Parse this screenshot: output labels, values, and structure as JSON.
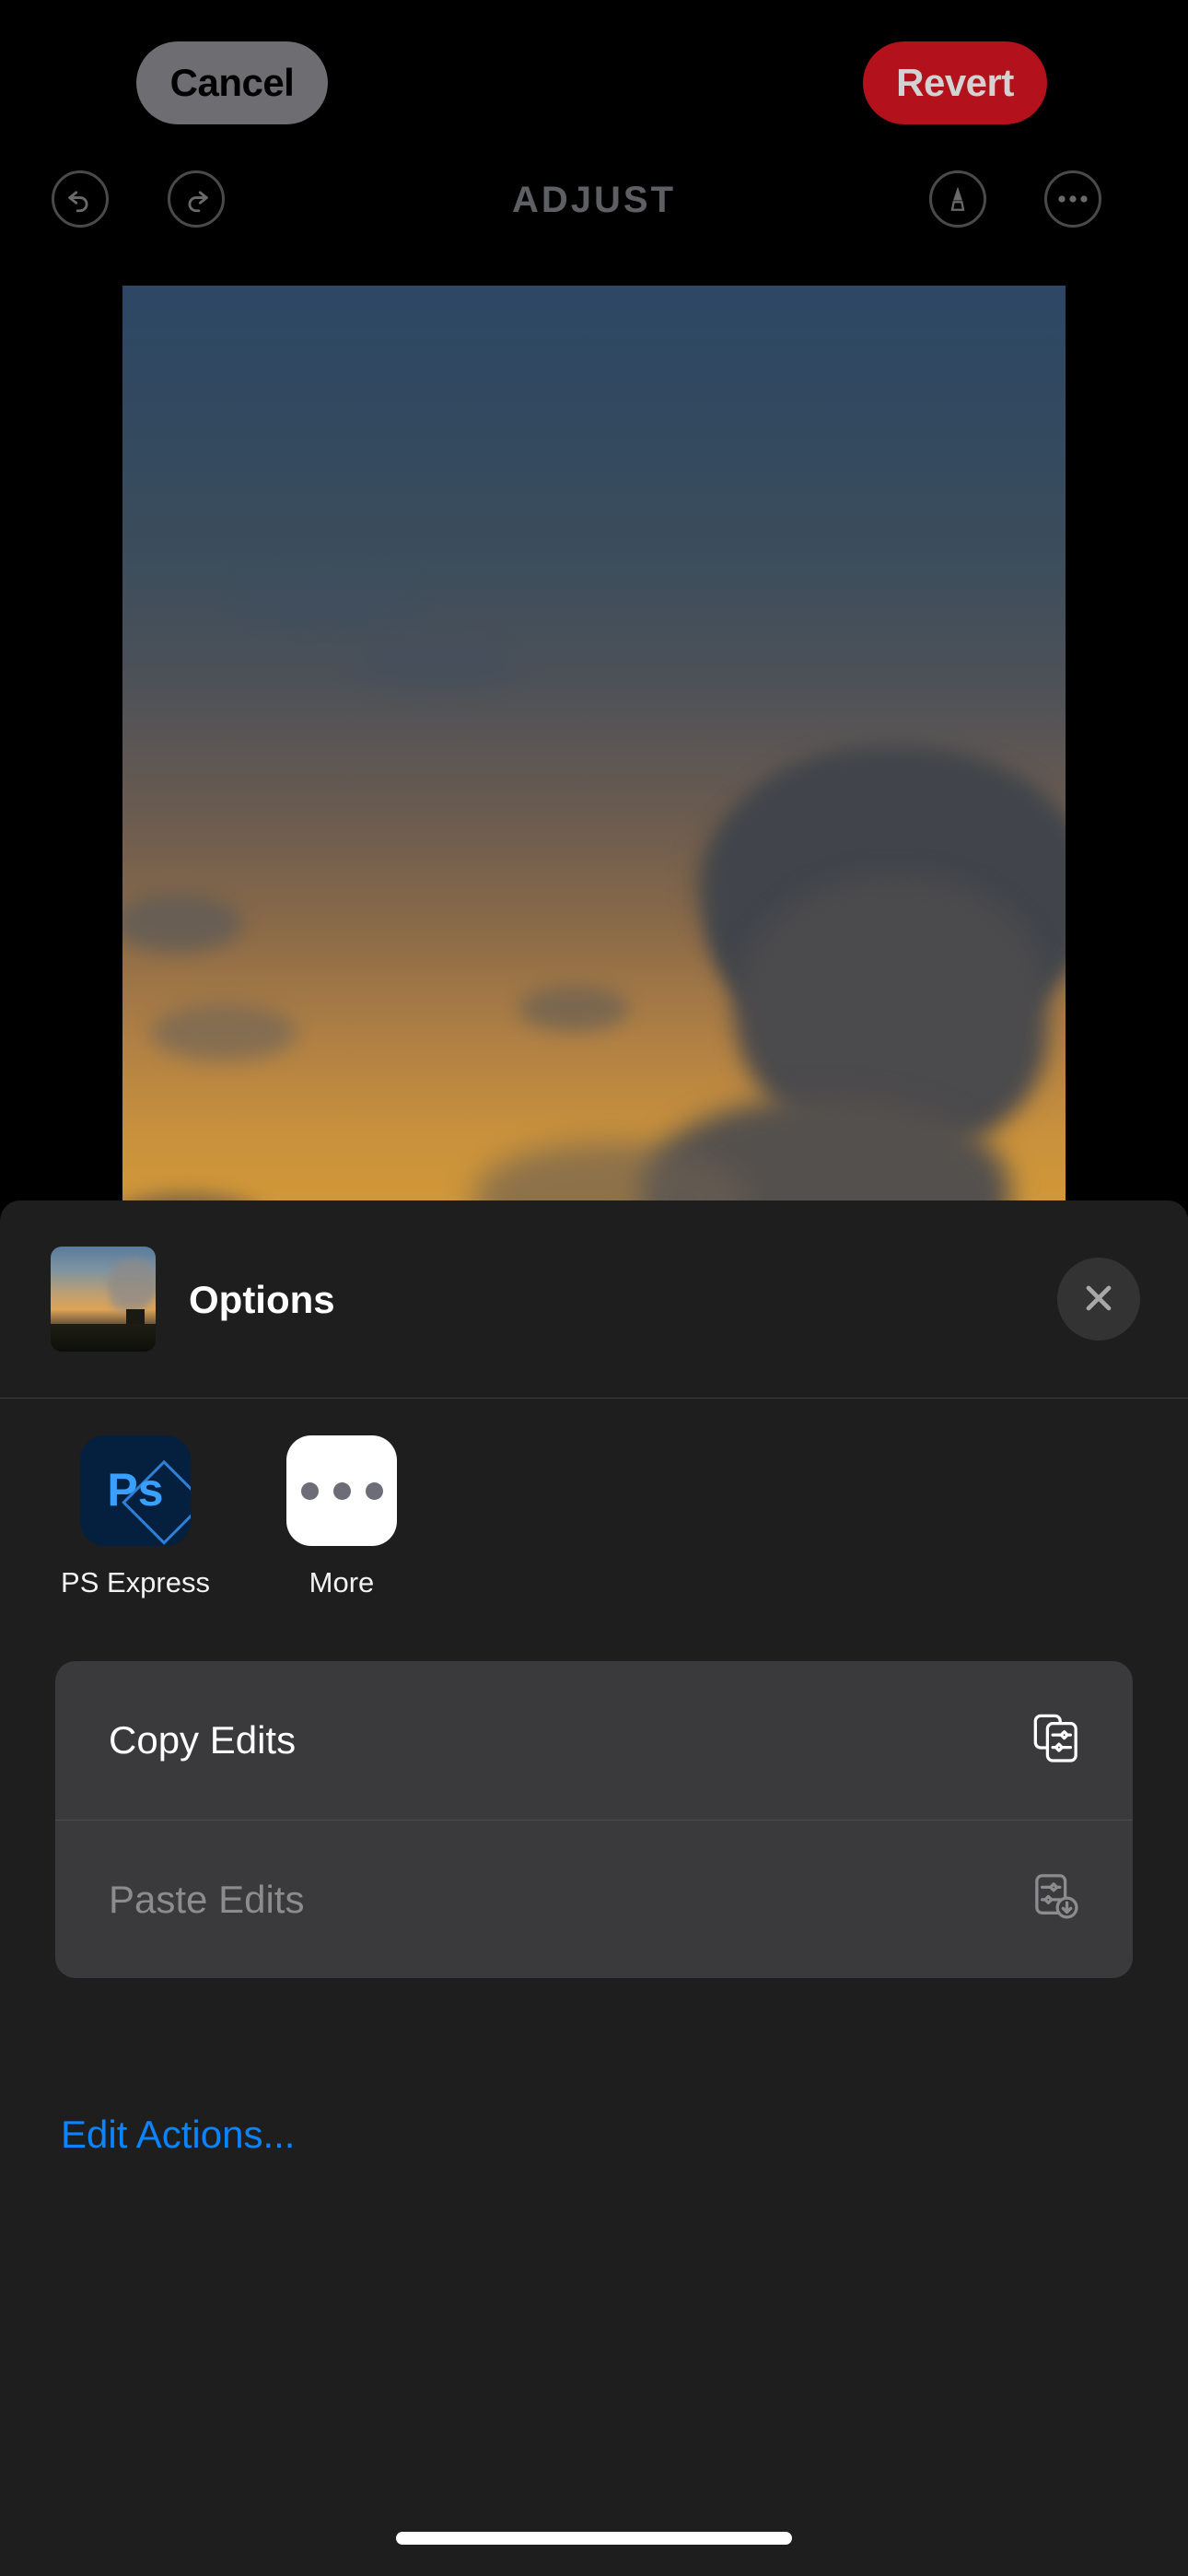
{
  "top_bar": {
    "cancel_label": "Cancel",
    "revert_label": "Revert",
    "cancel_bg": "#6d6d72",
    "revert_bg": "#b3121c"
  },
  "edit_bar": {
    "title": "ADJUST",
    "undo_icon": "undo-arrow-icon",
    "redo_icon": "redo-arrow-icon",
    "markup_icon": "markup-pen-icon",
    "more_icon": "ellipsis-icon"
  },
  "photo": {
    "description": "sunset sky photo",
    "alt": "Sunset sky with dark clouds over a city"
  },
  "sheet": {
    "title": "Options",
    "close_icon": "close-x-icon",
    "thumbnail_name": "photo-thumbnail",
    "apps": [
      {
        "label": "PS Express",
        "icon": "photoshop-express-icon",
        "glyph": "Ps"
      },
      {
        "label": "More",
        "icon": "more-ellipsis-icon"
      }
    ],
    "actions": [
      {
        "label": "Copy Edits",
        "icon": "copy-edits-icon",
        "enabled": true
      },
      {
        "label": "Paste Edits",
        "icon": "paste-edits-icon",
        "enabled": false
      }
    ],
    "edit_actions_label": "Edit Actions...",
    "accent_color": "#0a84ff"
  }
}
